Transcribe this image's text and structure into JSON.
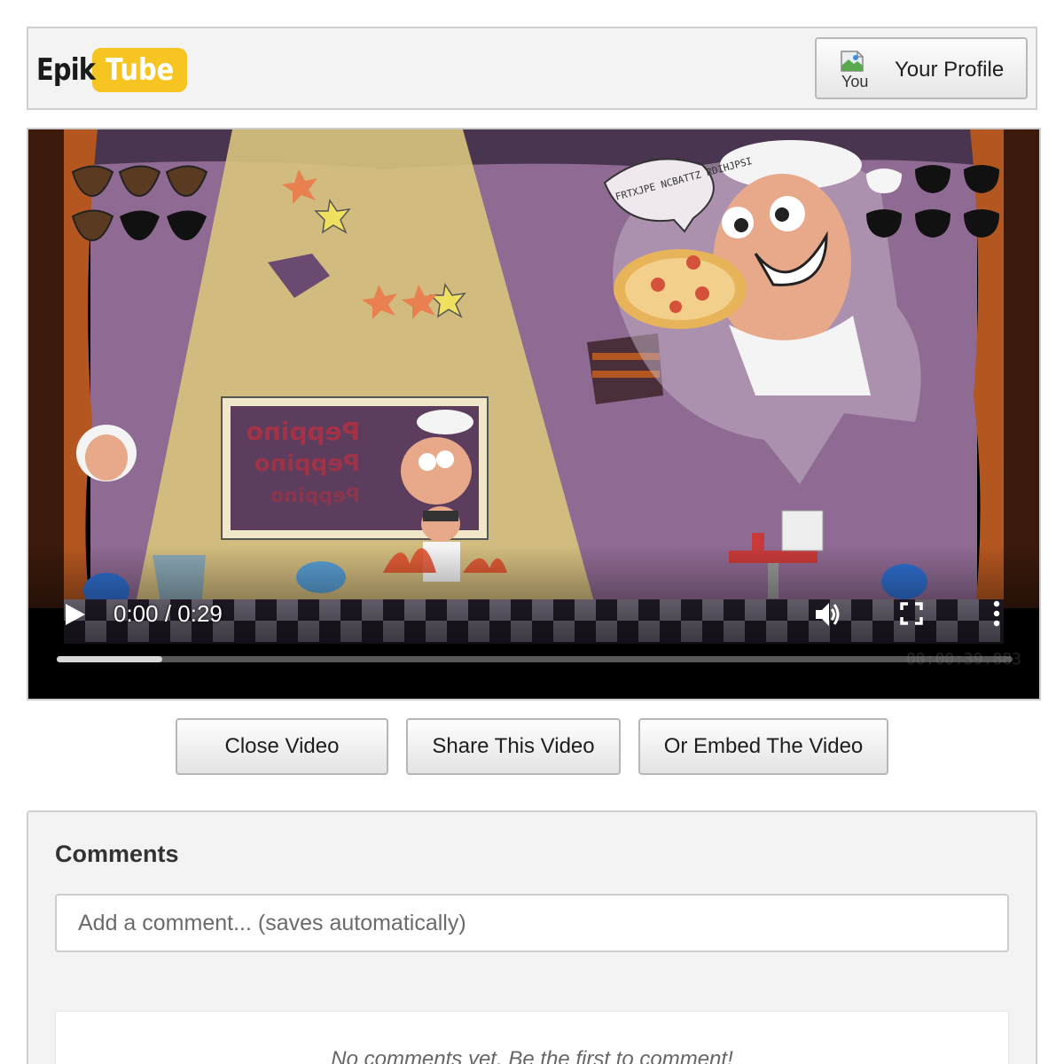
{
  "header": {
    "logo": {
      "part1": "Epik",
      "part2": "Tube"
    },
    "profile_button": {
      "label": "Your Profile",
      "image_alt": "You"
    }
  },
  "player": {
    "time_display": "0:00 / 0:29",
    "progress_fraction": 0.11,
    "overlay_timestamp": "00:00:39.883",
    "sign_text": "FRTXJPE NCBATTZ RDIHJPSI",
    "icons": {
      "play": "play-icon",
      "volume": "volume-icon",
      "fullscreen": "fullscreen-icon",
      "more": "more-vert-icon"
    }
  },
  "actions": {
    "close": "Close Video",
    "share": "Share This Video",
    "embed": "Or Embed The Video"
  },
  "comments": {
    "title": "Comments",
    "input_placeholder": "Add a comment... (saves automatically)",
    "empty_message": "No comments yet. Be the first to comment!"
  },
  "colors": {
    "logo_tube_bg": "#f6c521",
    "scene_wall": "#8f6a93",
    "spotlight": "#d8c47c",
    "curtain": "#b3561f",
    "floor_check": "#3a2f45"
  }
}
